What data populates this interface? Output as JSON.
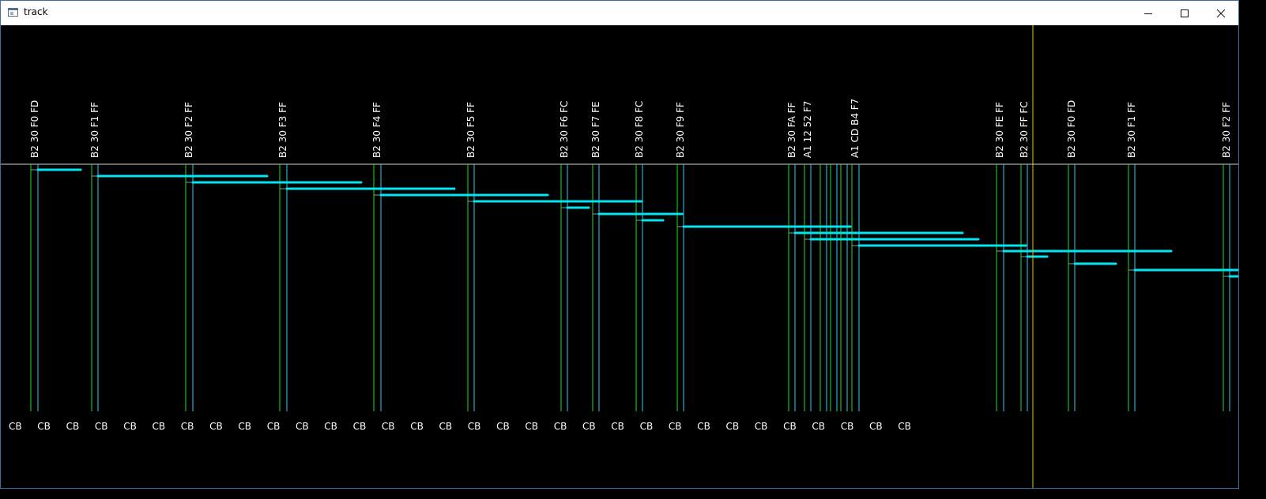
{
  "window": {
    "title": "track",
    "minimize_icon": "minimize-icon",
    "maximize_icon": "maximize-icon",
    "close_icon": "close-icon"
  },
  "colors": {
    "background": "#000000",
    "green_marker": "#22dd22",
    "cyan_marker": "#33ccee",
    "span_bar": "#00e5f0",
    "baseline": "#cfcfcf",
    "cursor_line": "#d6c21e",
    "label_text": "#ffffff"
  },
  "markers": [
    {
      "label": "B2 30 F0 FD"
    },
    {
      "label": "B2 30 F1 FF"
    },
    {
      "label": "B2 30 F2 FF"
    },
    {
      "label": "B2 30 F3 FF"
    },
    {
      "label": "B2 30 F4 FF"
    },
    {
      "label": "B2 30 F5 FF"
    },
    {
      "label": "B2 30 F6 FC"
    },
    {
      "label": "B2 30 F7 FE"
    },
    {
      "label": "B2 30 F8 FC"
    },
    {
      "label": "B2 30 F9 FF"
    },
    {
      "label": "B2 30 FA FF"
    },
    {
      "label": "A1 12 52 F7"
    },
    {
      "label": ""
    },
    {
      "label": ""
    },
    {
      "label": ""
    },
    {
      "label": ""
    },
    {
      "label": "A1 CD B4 F7"
    },
    {
      "label": "B2 30 FE FF"
    },
    {
      "label": "B2 30 FF FC"
    },
    {
      "label": "B2 30 F0 FD"
    },
    {
      "label": "B2 30 F1 FF"
    },
    {
      "label": "B2 30 F2 FF"
    }
  ],
  "bottom_labels": [
    "CB",
    "CB",
    "CB",
    "CB",
    "CB",
    "CB",
    "CB",
    "CB",
    "CB",
    "CB",
    "CB",
    "CB",
    "CB",
    "CB",
    "CB",
    "CB",
    "CB",
    "CB",
    "CB",
    "CB",
    "CB",
    "CB",
    "CB",
    "CB",
    "CB",
    "CB",
    "CB",
    "CB",
    "CB",
    "CB",
    "CB",
    "CB"
  ]
}
